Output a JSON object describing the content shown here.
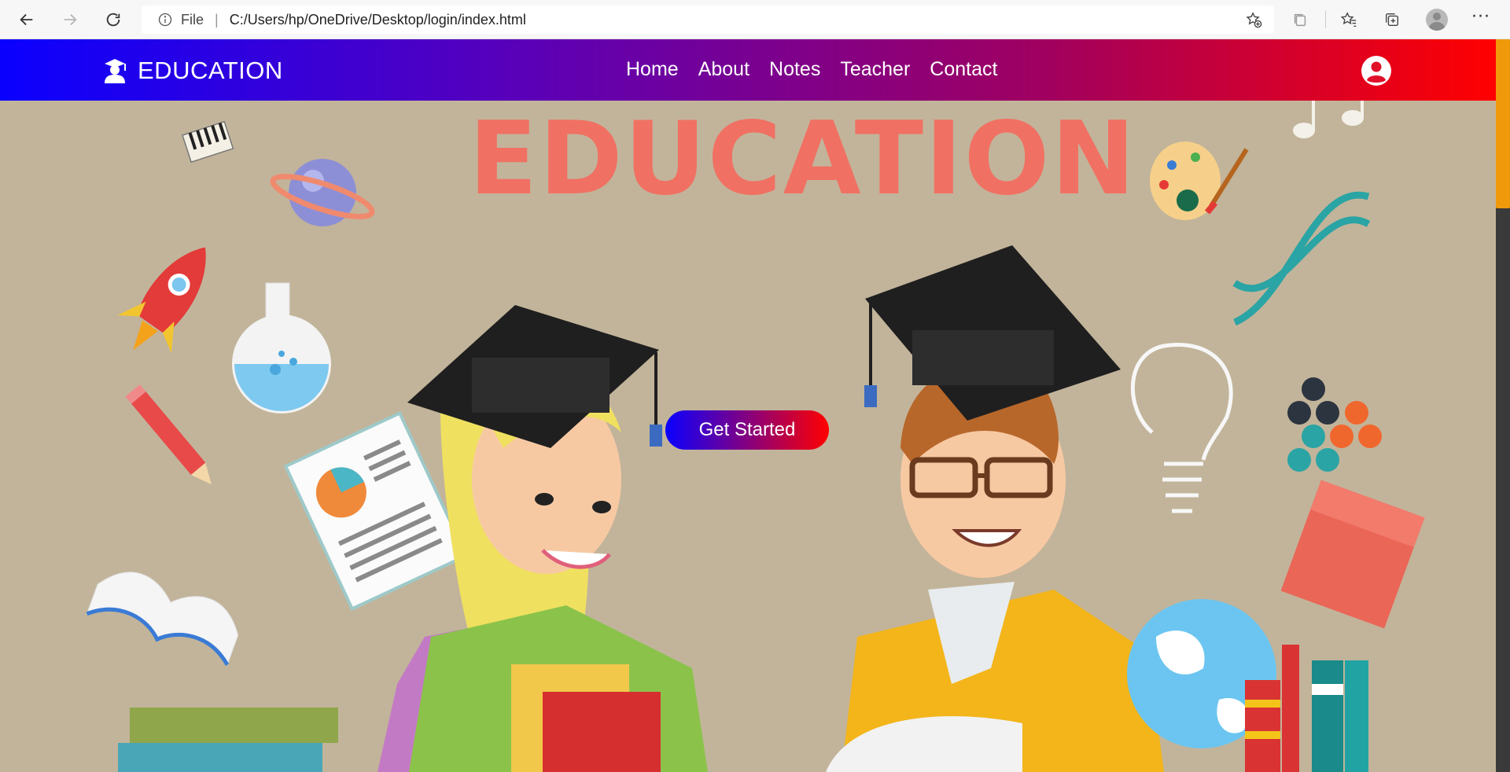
{
  "browser": {
    "file_label": "File",
    "separator": "|",
    "url": "C:/Users/hp/OneDrive/Desktop/login/index.html",
    "more_label": "···"
  },
  "site": {
    "brand": "EDUCATION",
    "nav": [
      "Home",
      "About",
      "Notes",
      "Teacher",
      "Contact"
    ]
  },
  "hero": {
    "title": "EDUCATION",
    "cta_label": "Get Started"
  },
  "colors": {
    "header_gradient_start": "#0a00ff",
    "header_gradient_end": "#ff0000",
    "hero_background": "#c2b49a",
    "hero_title": "#f07163",
    "scroll_thumb": "#f09a0b"
  },
  "icons": {
    "back": "arrow-left-icon",
    "forward": "arrow-right-icon",
    "refresh": "refresh-icon",
    "info": "info-icon",
    "add_favorite": "star-plus-icon",
    "collections": "collections-icon",
    "favorites": "favorites-icon",
    "brand": "graduate-icon",
    "user": "user-circle-icon"
  }
}
